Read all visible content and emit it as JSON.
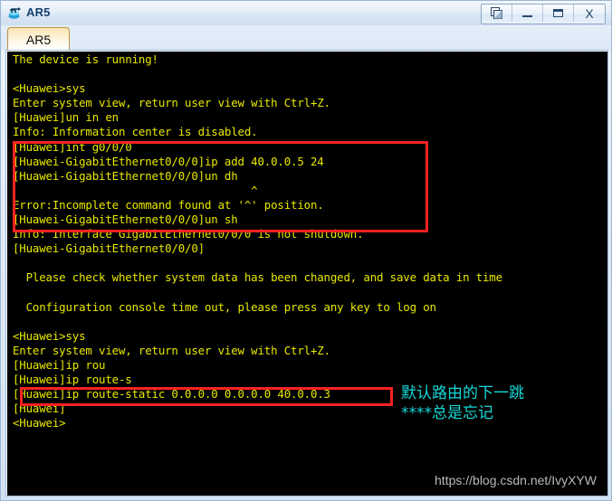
{
  "window": {
    "title": "AR5",
    "app_icon": "router-icon",
    "controls": [
      {
        "name": "restore-layers-button",
        "glyph": "layers"
      },
      {
        "name": "minimize-button",
        "glyph": "minimize"
      },
      {
        "name": "maximize-button",
        "glyph": "maximize"
      },
      {
        "name": "close-button",
        "glyph": "X"
      }
    ]
  },
  "tabs": [
    {
      "label": "AR5",
      "active": true
    }
  ],
  "terminal": {
    "background": "#000000",
    "foreground": "#e8e800",
    "lines": [
      "The device is running!",
      "",
      "<Huawei>sys",
      "Enter system view, return user view with Ctrl+Z.",
      "[Huawei]un in en",
      "Info: Information center is disabled.",
      "[Huawei]int g0/0/0",
      "[Huawei-GigabitEthernet0/0/0]ip add 40.0.0.5 24",
      "[Huawei-GigabitEthernet0/0/0]un dh",
      "                                    ^",
      "Error:Incomplete command found at '^' position.",
      "[Huawei-GigabitEthernet0/0/0]un sh",
      "Info: Interface GigabitEthernet0/0/0 is not shutdown.",
      "[Huawei-GigabitEthernet0/0/0]",
      "",
      "  Please check whether system data has been changed, and save data in time",
      "",
      "  Configuration console time out, please press any key to log on",
      "",
      "<Huawei>sys",
      "Enter system view, return user view with Ctrl+Z.",
      "[Huawei]ip rou",
      "[Huawei]ip route-s",
      "[Huawei]ip route-static 0.0.0.0 0.0.0.0 40.0.0.3",
      "[Huawei]",
      "<Huawei>"
    ]
  },
  "annotations": {
    "highlight_color": "#f62222",
    "note_color": "#14d8d8",
    "note_text": "默认路由的下一跳\n****总是忘记",
    "boxes": [
      {
        "name": "redbox-interface",
        "label": "interface-config-highlight"
      },
      {
        "name": "redbox-route",
        "label": "static-route-highlight"
      }
    ]
  },
  "watermark": {
    "text": "https://blog.csdn.net/IvyXYW"
  }
}
